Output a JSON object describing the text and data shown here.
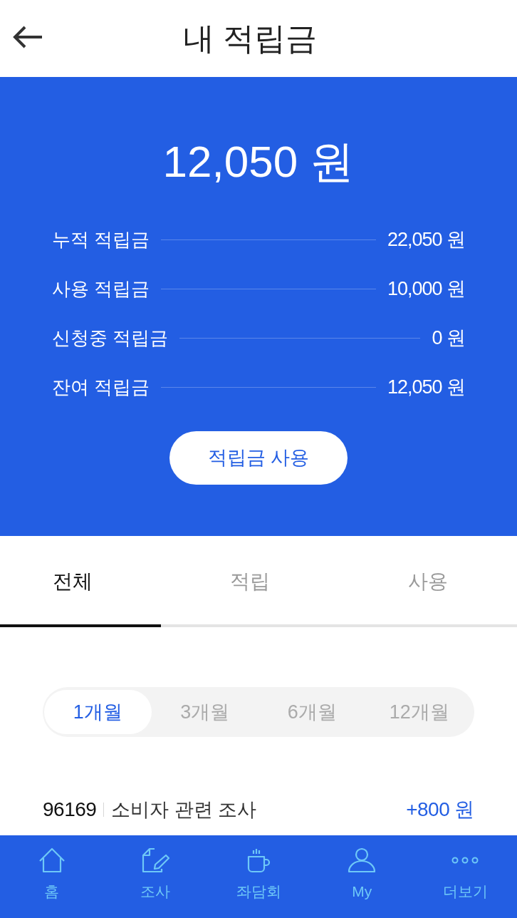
{
  "header": {
    "title": "내 적립금"
  },
  "balance": {
    "amount": "12,050 원",
    "rows": [
      {
        "label": "누적 적립금",
        "value": "22,050 원"
      },
      {
        "label": "사용 적립금",
        "value": "10,000 원"
      },
      {
        "label": "신청중 적립금",
        "value": "0 원"
      },
      {
        "label": "잔여 적립금",
        "value": "12,050 원"
      }
    ],
    "button": "적립금 사용"
  },
  "tabs": [
    {
      "label": "전체",
      "selected": true
    },
    {
      "label": "적립",
      "selected": false
    },
    {
      "label": "사용",
      "selected": false
    }
  ],
  "periods": [
    {
      "label": "1개월",
      "selected": true
    },
    {
      "label": "3개월",
      "selected": false
    },
    {
      "label": "6개월",
      "selected": false
    },
    {
      "label": "12개월",
      "selected": false
    }
  ],
  "transactions": [
    {
      "id": "96169",
      "title": "소비자 관련 조사",
      "amount": "+800 원"
    }
  ],
  "bottom_nav": [
    {
      "label": "홈",
      "kind": "home"
    },
    {
      "label": "조사",
      "kind": "survey"
    },
    {
      "label": "좌담회",
      "kind": "meeting"
    },
    {
      "label": "My",
      "kind": "profile"
    },
    {
      "label": "더보기",
      "kind": "more"
    }
  ]
}
